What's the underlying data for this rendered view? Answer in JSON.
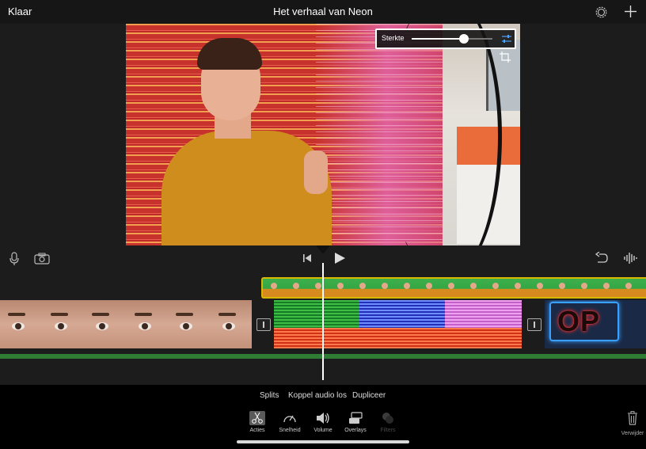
{
  "topbar": {
    "done_label": "Klaar",
    "title": "Het verhaal van Neon",
    "settings_icon": "gear-icon",
    "add_icon": "plus-icon"
  },
  "viewer": {
    "strength": {
      "label": "Sterkte",
      "value": 0.65
    },
    "adjust_icon": "sliders-icon",
    "crop_icon": "crop-icon"
  },
  "controls": {
    "mic_icon": "microphone-icon",
    "camera_icon": "camera-icon",
    "skip_start_icon": "skip-to-start-icon",
    "play_icon": "play-icon",
    "undo_icon": "undo-icon",
    "waveform_icon": "waveform-icon"
  },
  "timeline": {
    "clips": [
      "eyes-clip",
      "rgb-clip",
      "neon-clip",
      "green-screen-clip"
    ],
    "neon_sign_text": "OP"
  },
  "actions": {
    "split_label": "Splits",
    "detach_label": "Koppel audio los",
    "duplicate_label": "Dupliceer"
  },
  "tools": [
    {
      "label": "Acties",
      "icon": "scissors-icon",
      "selected": true
    },
    {
      "label": "Snelheid",
      "icon": "speedometer-icon",
      "selected": false
    },
    {
      "label": "Volume",
      "icon": "speaker-icon",
      "selected": false
    },
    {
      "label": "Overlays",
      "icon": "overlays-icon",
      "selected": false
    },
    {
      "label": "Filters",
      "icon": "filters-icon",
      "selected": false,
      "disabled": true
    }
  ],
  "trash": {
    "label": "Verwijder",
    "icon": "trash-icon"
  },
  "colors": {
    "accent_yellow": "#d9b800",
    "audio_track_green": "#2f7d35",
    "background": "#1c1c1c"
  }
}
